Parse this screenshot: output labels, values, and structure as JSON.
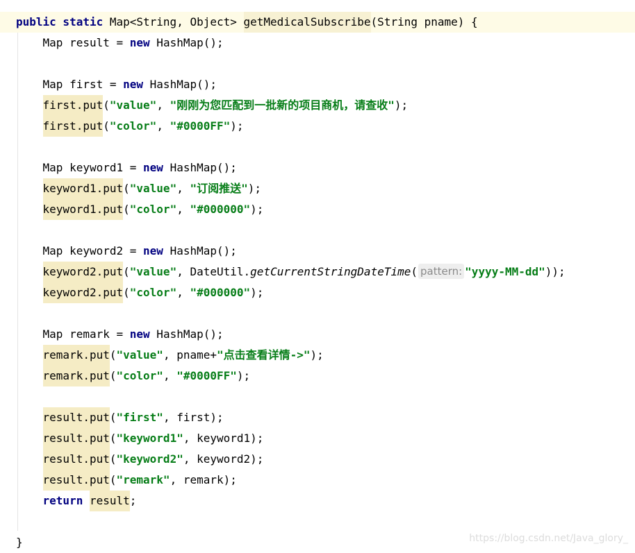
{
  "editor": {
    "lines": [
      {
        "hl": true,
        "segs": [
          {
            "t": "public static ",
            "c": "kw"
          },
          {
            "t": "Map<String, Object> "
          },
          {
            "t": "getMedicalSubscribe",
            "c": "mark-m"
          },
          {
            "t": "(String pname) {"
          }
        ]
      },
      {
        "segs": [
          {
            "t": "    Map result = "
          },
          {
            "t": "new",
            "c": "kw"
          },
          {
            "t": " HashMap();"
          }
        ]
      },
      {
        "segs": []
      },
      {
        "segs": [
          {
            "t": "    Map first = "
          },
          {
            "t": "new",
            "c": "kw"
          },
          {
            "t": " HashMap();"
          }
        ]
      },
      {
        "segs": [
          {
            "t": "    "
          },
          {
            "t": "first.put",
            "c": "mark"
          },
          {
            "t": "("
          },
          {
            "t": "\"value\"",
            "c": "str"
          },
          {
            "t": ", "
          },
          {
            "t": "\"刚刚为您匹配到一批新的项目商机，请查收\"",
            "c": "str"
          },
          {
            "t": ");"
          }
        ]
      },
      {
        "segs": [
          {
            "t": "    "
          },
          {
            "t": "first.put",
            "c": "mark"
          },
          {
            "t": "("
          },
          {
            "t": "\"color\"",
            "c": "str"
          },
          {
            "t": ", "
          },
          {
            "t": "\"#0000FF\"",
            "c": "str"
          },
          {
            "t": ");"
          }
        ]
      },
      {
        "segs": []
      },
      {
        "segs": [
          {
            "t": "    Map keyword1 = "
          },
          {
            "t": "new",
            "c": "kw"
          },
          {
            "t": " HashMap();"
          }
        ]
      },
      {
        "segs": [
          {
            "t": "    "
          },
          {
            "t": "keyword1.put",
            "c": "mark"
          },
          {
            "t": "("
          },
          {
            "t": "\"value\"",
            "c": "str"
          },
          {
            "t": ", "
          },
          {
            "t": "\"订阅推送\"",
            "c": "str"
          },
          {
            "t": ");"
          }
        ]
      },
      {
        "segs": [
          {
            "t": "    "
          },
          {
            "t": "keyword1.put",
            "c": "mark"
          },
          {
            "t": "("
          },
          {
            "t": "\"color\"",
            "c": "str"
          },
          {
            "t": ", "
          },
          {
            "t": "\"#000000\"",
            "c": "str"
          },
          {
            "t": ");"
          }
        ]
      },
      {
        "segs": []
      },
      {
        "segs": [
          {
            "t": "    Map keyword2 = "
          },
          {
            "t": "new",
            "c": "kw"
          },
          {
            "t": " HashMap();"
          }
        ]
      },
      {
        "segs": [
          {
            "t": "    "
          },
          {
            "t": "keyword2.put",
            "c": "mark"
          },
          {
            "t": "("
          },
          {
            "t": "\"value\"",
            "c": "str"
          },
          {
            "t": ", DateUtil."
          },
          {
            "t": "getCurrentStringDateTime",
            "c": "italic"
          },
          {
            "t": "("
          },
          {
            "t": "pattern:",
            "c": "hint"
          },
          {
            "t": "\"yyyy-MM-dd\"",
            "c": "str"
          },
          {
            "t": "));"
          }
        ]
      },
      {
        "segs": [
          {
            "t": "    "
          },
          {
            "t": "keyword2.put",
            "c": "mark"
          },
          {
            "t": "("
          },
          {
            "t": "\"color\"",
            "c": "str"
          },
          {
            "t": ", "
          },
          {
            "t": "\"#000000\"",
            "c": "str"
          },
          {
            "t": ");"
          }
        ]
      },
      {
        "segs": []
      },
      {
        "segs": [
          {
            "t": "    Map remark = "
          },
          {
            "t": "new",
            "c": "kw"
          },
          {
            "t": " HashMap();"
          }
        ]
      },
      {
        "segs": [
          {
            "t": "    "
          },
          {
            "t": "remark.put",
            "c": "mark"
          },
          {
            "t": "("
          },
          {
            "t": "\"value\"",
            "c": "str"
          },
          {
            "t": ", pname+"
          },
          {
            "t": "\"点击查看详情->\"",
            "c": "str"
          },
          {
            "t": ");"
          }
        ]
      },
      {
        "segs": [
          {
            "t": "    "
          },
          {
            "t": "remark.put",
            "c": "mark"
          },
          {
            "t": "("
          },
          {
            "t": "\"color\"",
            "c": "str"
          },
          {
            "t": ", "
          },
          {
            "t": "\"#0000FF\"",
            "c": "str"
          },
          {
            "t": ");"
          }
        ]
      },
      {
        "segs": []
      },
      {
        "segs": [
          {
            "t": "    "
          },
          {
            "t": "result.put",
            "c": "mark"
          },
          {
            "t": "("
          },
          {
            "t": "\"first\"",
            "c": "str"
          },
          {
            "t": ", first);"
          }
        ]
      },
      {
        "segs": [
          {
            "t": "    "
          },
          {
            "t": "result.put",
            "c": "mark"
          },
          {
            "t": "("
          },
          {
            "t": "\"keyword1\"",
            "c": "str"
          },
          {
            "t": ", keyword1);"
          }
        ]
      },
      {
        "segs": [
          {
            "t": "    "
          },
          {
            "t": "result.put",
            "c": "mark"
          },
          {
            "t": "("
          },
          {
            "t": "\"keyword2\"",
            "c": "str"
          },
          {
            "t": ", keyword2);"
          }
        ]
      },
      {
        "segs": [
          {
            "t": "    "
          },
          {
            "t": "result.put",
            "c": "mark"
          },
          {
            "t": "("
          },
          {
            "t": "\"remark\"",
            "c": "str"
          },
          {
            "t": ", remark);"
          }
        ]
      },
      {
        "segs": [
          {
            "t": "    "
          },
          {
            "t": "return",
            "c": "kw"
          },
          {
            "t": " "
          },
          {
            "t": "result",
            "c": "mark"
          },
          {
            "t": ";"
          }
        ]
      },
      {
        "segs": []
      },
      {
        "segs": [
          {
            "t": "}"
          }
        ]
      }
    ]
  },
  "watermark": "https://blog.csdn.net/Java_glory_",
  "colors": {
    "keyword": "#000080",
    "string": "#067d17",
    "usage_highlight": "#f5ecc5",
    "current_line": "#fefbe6",
    "param_hint_bg": "#eeeeee",
    "param_hint_text": "#8a8a8a"
  }
}
